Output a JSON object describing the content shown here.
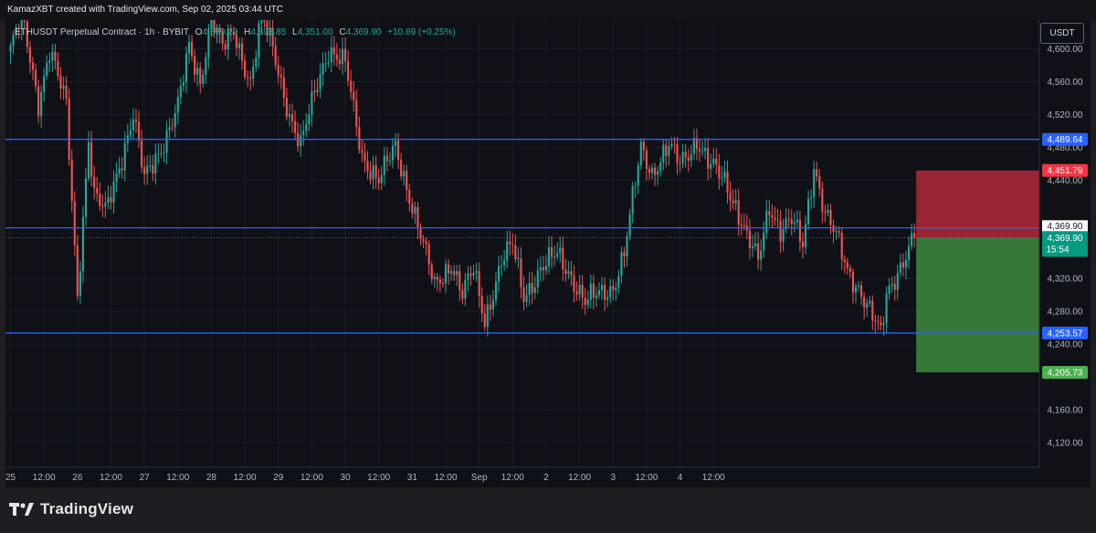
{
  "header": {
    "text": "KamazXBT created with TradingView.com, Sep 02, 2025 03:44 UTC"
  },
  "legend": {
    "symbol": "ETHUSDT Perpetual Contract · 1h · BYBIT",
    "open_label": "O",
    "open": "4,359.29",
    "high_label": "H",
    "high": "4,393.85",
    "low_label": "L",
    "low": "4,351.00",
    "close_label": "C",
    "close": "4,369.90",
    "change": "+10.69 (+0.25%)"
  },
  "currency_button": "USDT",
  "brand": {
    "name": "TradingView",
    "icon": "tradingview-logo-icon"
  },
  "colors": {
    "up": "#26a69a",
    "down": "#ef5350",
    "level": "#2962ff",
    "risk": "#b2283a",
    "reward": "#3d8b3d"
  },
  "chart_data": {
    "type": "candlestick",
    "timeframe": "1h",
    "ylim": [
      4090,
      4635
    ],
    "y_ticks": [
      {
        "value": 4600,
        "label": "4,600.00"
      },
      {
        "value": 4560,
        "label": "4,560.00"
      },
      {
        "value": 4520,
        "label": "4,520.00"
      },
      {
        "value": 4480,
        "label": "4,480.00"
      },
      {
        "value": 4440,
        "label": "4,440.00"
      },
      {
        "value": 4320,
        "label": "4,320.00"
      },
      {
        "value": 4280,
        "label": "4,280.00"
      },
      {
        "value": 4240,
        "label": "4,240.00"
      },
      {
        "value": 4160,
        "label": "4,160.00"
      },
      {
        "value": 4120,
        "label": "4,120.00"
      }
    ],
    "x_ticks": [
      "25",
      "12:00",
      "26",
      "12:00",
      "27",
      "12:00",
      "28",
      "12:00",
      "29",
      "12:00",
      "30",
      "12:00",
      "31",
      "12:00",
      "Sep",
      "12:00",
      "2",
      "12:00",
      "3",
      "12:00",
      "4",
      "12:00"
    ],
    "horizontal_levels": [
      {
        "value": 4489.64,
        "label": "4,489.64"
      },
      {
        "value": 4381.84,
        "label": "4,381.84"
      },
      {
        "value": 4253.57,
        "label": "4,253.57"
      }
    ],
    "last_price": {
      "value": 4369.9,
      "label": "4,369.90",
      "countdown": "15:54"
    },
    "position": {
      "type": "short",
      "entry": 4369.9,
      "stop": {
        "value": 4451.79,
        "label": "4,451.79"
      },
      "target": {
        "value": 4205.73,
        "label": "4,205.73"
      }
    },
    "anchors": [
      [
        0,
        4600
      ],
      [
        4,
        4640
      ],
      [
        10,
        4535
      ],
      [
        14,
        4600
      ],
      [
        20,
        4530
      ],
      [
        24,
        4300
      ],
      [
        28,
        4490
      ],
      [
        30,
        4420
      ],
      [
        34,
        4400
      ],
      [
        40,
        4470
      ],
      [
        44,
        4520
      ],
      [
        48,
        4440
      ],
      [
        54,
        4480
      ],
      [
        60,
        4530
      ],
      [
        64,
        4600
      ],
      [
        68,
        4560
      ],
      [
        72,
        4640
      ],
      [
        76,
        4600
      ],
      [
        80,
        4620
      ],
      [
        86,
        4560
      ],
      [
        90,
        4640
      ],
      [
        94,
        4600
      ],
      [
        100,
        4520
      ],
      [
        104,
        4480
      ],
      [
        110,
        4560
      ],
      [
        114,
        4600
      ],
      [
        120,
        4580
      ],
      [
        126,
        4470
      ],
      [
        132,
        4440
      ],
      [
        138,
        4480
      ],
      [
        144,
        4410
      ],
      [
        148,
        4360
      ],
      [
        152,
        4310
      ],
      [
        158,
        4340
      ],
      [
        162,
        4300
      ],
      [
        166,
        4330
      ],
      [
        170,
        4270
      ],
      [
        176,
        4340
      ],
      [
        180,
        4360
      ],
      [
        184,
        4300
      ],
      [
        190,
        4330
      ],
      [
        196,
        4350
      ],
      [
        200,
        4330
      ],
      [
        206,
        4290
      ],
      [
        210,
        4300
      ],
      [
        216,
        4310
      ],
      [
        220,
        4350
      ],
      [
        226,
        4480
      ],
      [
        230,
        4450
      ],
      [
        236,
        4480
      ],
      [
        240,
        4460
      ],
      [
        246,
        4490
      ],
      [
        250,
        4460
      ],
      [
        256,
        4440
      ],
      [
        260,
        4410
      ],
      [
        264,
        4370
      ],
      [
        268,
        4340
      ],
      [
        272,
        4410
      ],
      [
        276,
        4380
      ],
      [
        280,
        4390
      ],
      [
        284,
        4360
      ],
      [
        288,
        4460
      ],
      [
        292,
        4400
      ],
      [
        296,
        4370
      ],
      [
        300,
        4330
      ],
      [
        304,
        4310
      ],
      [
        308,
        4280
      ],
      [
        312,
        4250
      ],
      [
        314,
        4300
      ],
      [
        318,
        4330
      ],
      [
        322,
        4355
      ],
      [
        324,
        4369.9
      ]
    ],
    "candle_count": 325,
    "future_bars": 43
  }
}
